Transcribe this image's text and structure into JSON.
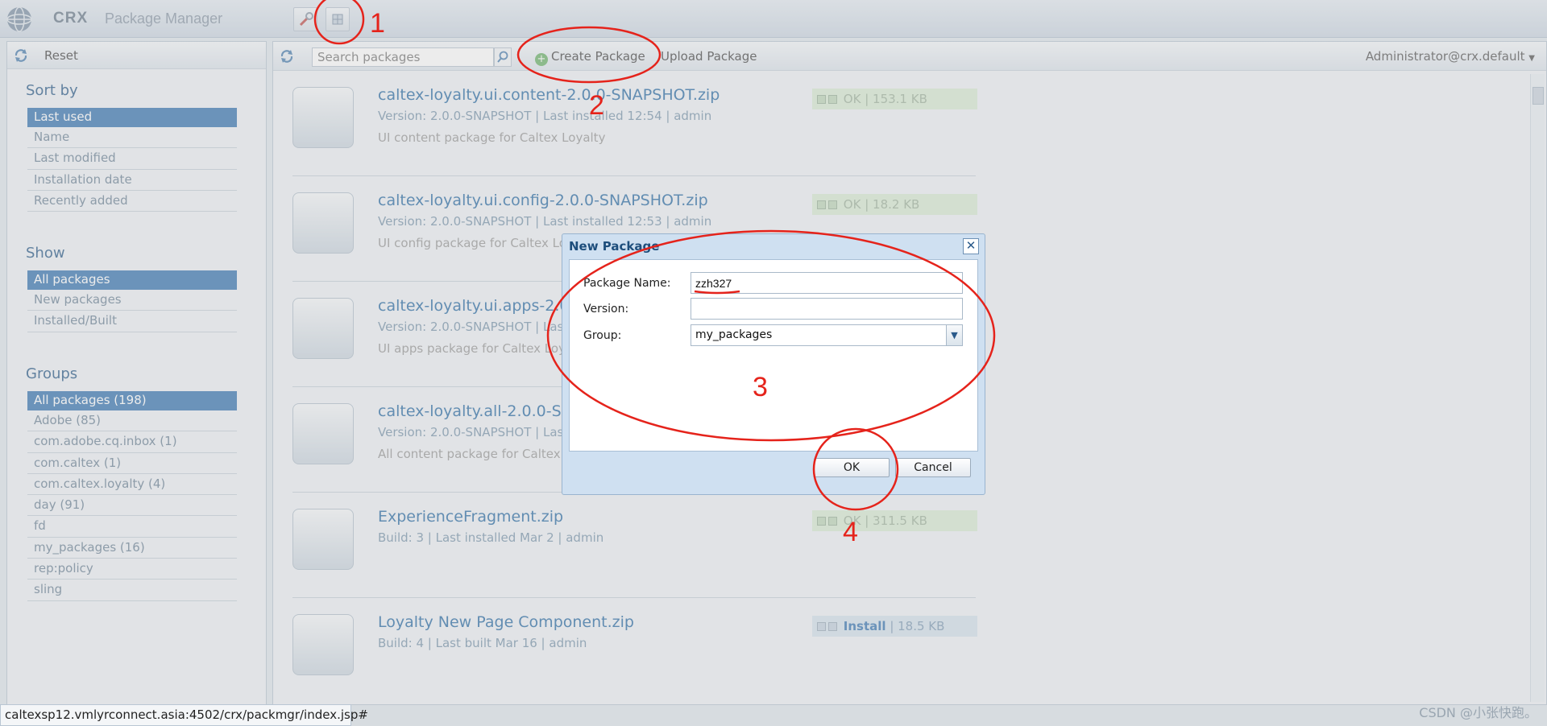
{
  "app": {
    "title_crx": "CRX",
    "title_pm": "Package Manager"
  },
  "sidebar": {
    "reset_label": "Reset",
    "sort_heading": "Sort by",
    "sort_items": [
      "Last used",
      "Name",
      "Last modified",
      "Installation date",
      "Recently added"
    ],
    "show_heading": "Show",
    "show_items": [
      "All packages",
      "New packages",
      "Installed/Built"
    ],
    "groups_heading": "Groups",
    "group_items": [
      "All packages (198)",
      "Adobe (85)",
      "com.adobe.cq.inbox (1)",
      "com.caltex (1)",
      "com.caltex.loyalty (4)",
      "day (91)",
      "fd",
      "my_packages (16)",
      "rep:policy",
      "sling"
    ]
  },
  "toolbar": {
    "search_placeholder": "Search packages",
    "create_label": "Create Package",
    "upload_label": "Upload Package",
    "user": "Administrator@crx.default"
  },
  "packages": [
    {
      "name": "caltex-loyalty.ui.content-2.0.0-SNAPSHOT.zip",
      "meta": "Version: 2.0.0-SNAPSHOT | Last installed 12:54 | admin",
      "desc": "UI content package for Caltex Loyalty",
      "status": "OK",
      "size": "153.1 KB"
    },
    {
      "name": "caltex-loyalty.ui.config-2.0.0-SNAPSHOT.zip",
      "meta": "Version: 2.0.0-SNAPSHOT | Last installed 12:53 | admin",
      "desc": "UI config package for Caltex Lo",
      "status": "OK",
      "size": "18.2 KB"
    },
    {
      "name": "caltex-loyalty.ui.apps-2.0",
      "meta": "Version: 2.0.0-SNAPSHOT | Las",
      "desc": "UI apps package for Caltex Loy",
      "status": "",
      "size": ""
    },
    {
      "name": "caltex-loyalty.all-2.0.0-S",
      "meta": "Version: 2.0.0-SNAPSHOT | Las",
      "desc": "All content package for Caltex L",
      "status": "",
      "size": ""
    },
    {
      "name": "ExperienceFragment.zip",
      "meta": "Build: 3 | Last installed Mar 2 | admin",
      "desc": "",
      "status": "OK",
      "size": "311.5 KB"
    },
    {
      "name": "Loyalty New Page Component.zip",
      "meta": "Build: 4 | Last built Mar 16 | admin",
      "desc": "",
      "status": "Install",
      "size": "18.5 KB"
    }
  ],
  "dialog": {
    "title": "New Package",
    "close_glyph": "✕",
    "name_label": "Package Name:",
    "name_value": "zzh327",
    "version_label": "Version:",
    "version_value": "",
    "group_label": "Group:",
    "group_value": "my_packages",
    "ok_label": "OK",
    "cancel_label": "Cancel"
  },
  "annotations": [
    "1",
    "2",
    "3",
    "4"
  ],
  "statusbar": {
    "url": "caltexsp12.vmlyrconnect.asia:4502/crx/packmgr/index.jsp#"
  },
  "watermark": "CSDN @小张快跑。",
  "colors": {
    "accent": "#3a77b2",
    "link": "#2c6da6",
    "annotation": "#e5231b",
    "ok_bg": "#d9ecd5"
  }
}
